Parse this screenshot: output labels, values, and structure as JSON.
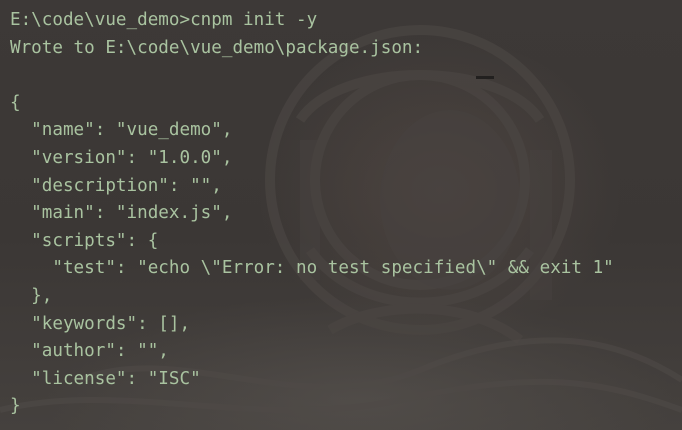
{
  "terminal": {
    "lines": [
      "E:\\code\\vue_demo>cnpm init -y",
      "Wrote to E:\\code\\vue_demo\\package.json:",
      "",
      "{",
      "  \"name\": \"vue_demo\",",
      "  \"version\": \"1.0.0\",",
      "  \"description\": \"\",",
      "  \"main\": \"index.js\",",
      "  \"scripts\": {",
      "    \"test\": \"echo \\\"Error: no test specified\\\" && exit 1\"",
      "  },",
      "  \"keywords\": [],",
      "  \"author\": \"\",",
      "  \"license\": \"ISC\"",
      "}"
    ]
  },
  "colors": {
    "text": "#a9c3a0",
    "background": "#3b3836"
  }
}
